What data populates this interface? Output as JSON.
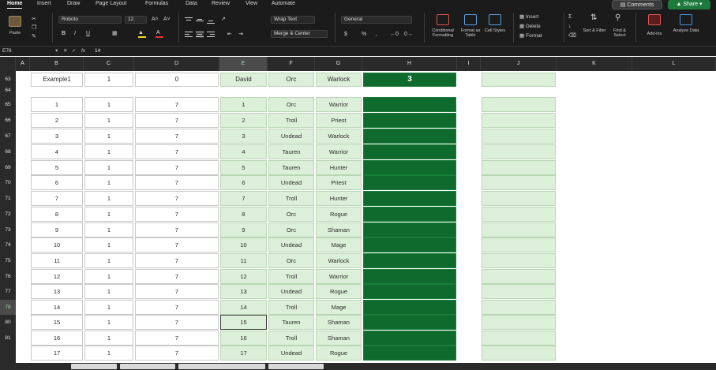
{
  "ribbon": {
    "tabs": [
      "Home",
      "Insert",
      "Draw",
      "Page Layout",
      "Formulas",
      "Data",
      "Review",
      "View",
      "Automate"
    ],
    "active_tab": "Home",
    "comments_label": "Comments",
    "share_label": "Share",
    "paste_label": "Paste",
    "font_name": "Roboto",
    "font_size": "12",
    "wrap_text_label": "Wrap Text",
    "merge_label": "Merge & Center",
    "number_format": "General",
    "conditional_label": "Conditional Formatting",
    "format_table_label": "Format as Table",
    "cell_styles_label": "Cell Styles",
    "insert_label": "Insert",
    "delete_label": "Delete",
    "format_label": "Format",
    "sort_filter_label": "Sort & Filter",
    "find_select_label": "Find & Select",
    "addins_label": "Add-ins",
    "analyze_label": "Analyze Data",
    "bold": "B",
    "italic": "I",
    "underline": "U",
    "currency": "$",
    "percent": "%"
  },
  "formula_bar": {
    "name_box": "E76",
    "fx": "fx",
    "value": "14"
  },
  "columns": [
    "A",
    "B",
    "C",
    "D",
    "E",
    "F",
    "G",
    "H",
    "I",
    "J",
    "K",
    "L"
  ],
  "selected_column": "E",
  "selected_row": "78",
  "row_numbers": [
    "63",
    "64",
    "65",
    "66",
    "67",
    "68",
    "69",
    "70",
    "71",
    "72",
    "73",
    "74",
    "75",
    "76",
    "77",
    "78",
    "80",
    "81"
  ],
  "header_row": {
    "B": "Example1",
    "C": "1",
    "D": "0",
    "E": "David",
    "F": "Orc",
    "G": "Warlock",
    "H": "3"
  },
  "rows": [
    {
      "B": "1",
      "C": "1",
      "D": "7",
      "E": "1",
      "F": "Orc",
      "G": "Warrior"
    },
    {
      "B": "2",
      "C": "1",
      "D": "7",
      "E": "2",
      "F": "Troll",
      "G": "Priest"
    },
    {
      "B": "3",
      "C": "1",
      "D": "7",
      "E": "3",
      "F": "Undead",
      "G": "Warlock"
    },
    {
      "B": "4",
      "C": "1",
      "D": "7",
      "E": "4",
      "F": "Tauren",
      "G": "Warrior"
    },
    {
      "B": "5",
      "C": "1",
      "D": "7",
      "E": "5",
      "F": "Tauren",
      "G": "Hunter"
    },
    {
      "B": "6",
      "C": "1",
      "D": "7",
      "E": "6",
      "F": "Undead",
      "G": "Priest"
    },
    {
      "B": "7",
      "C": "1",
      "D": "7",
      "E": "7",
      "F": "Troll",
      "G": "Hunter"
    },
    {
      "B": "8",
      "C": "1",
      "D": "7",
      "E": "8",
      "F": "Orc",
      "G": "Rogue"
    },
    {
      "B": "9",
      "C": "1",
      "D": "7",
      "E": "9",
      "F": "Orc",
      "G": "Shaman"
    },
    {
      "B": "10",
      "C": "1",
      "D": "7",
      "E": "10",
      "F": "Undead",
      "G": "Mage"
    },
    {
      "B": "11",
      "C": "1",
      "D": "7",
      "E": "11",
      "F": "Orc",
      "G": "Warlock"
    },
    {
      "B": "12",
      "C": "1",
      "D": "7",
      "E": "12",
      "F": "Troll",
      "G": "Warrior"
    },
    {
      "B": "13",
      "C": "1",
      "D": "7",
      "E": "13",
      "F": "Undead",
      "G": "Rogue"
    },
    {
      "B": "14",
      "C": "1",
      "D": "7",
      "E": "14",
      "F": "Troll",
      "G": "Mage"
    },
    {
      "B": "15",
      "C": "1",
      "D": "7",
      "E": "15",
      "F": "Tauren",
      "G": "Shaman"
    },
    {
      "B": "16",
      "C": "1",
      "D": "7",
      "E": "16",
      "F": "Troll",
      "G": "Shaman"
    },
    {
      "B": "17",
      "C": "1",
      "D": "7",
      "E": "17",
      "F": "Undead",
      "G": "Rogue"
    }
  ],
  "colors": {
    "accent_green": "#0f6a2e",
    "light_green": "#dcefd8",
    "share_green": "#1e7a3c"
  }
}
